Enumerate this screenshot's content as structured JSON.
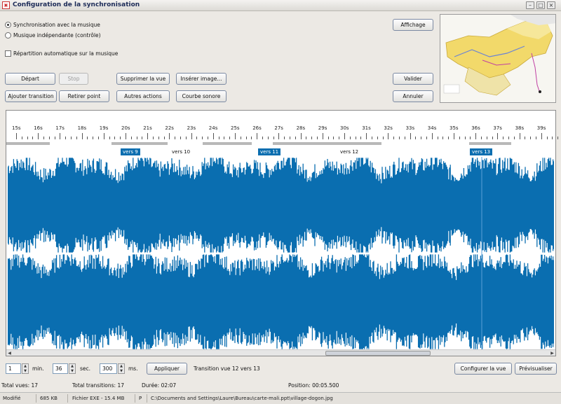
{
  "window": {
    "title": "Configuration de la synchronisation",
    "app_icon": "app-icon",
    "controls": [
      "minimize-icon",
      "maximize-icon",
      "close-icon"
    ]
  },
  "options": {
    "radio1": "Synchronisation avec la musique",
    "radio2": "Musique indépendante (contrôle)",
    "radio_selected": "radio1",
    "checkbox": "Répartition automatique sur la musique",
    "checkbox_checked": false
  },
  "buttons": {
    "affichage": "Affichage",
    "depart": "Départ",
    "stop": "Stop",
    "supprimer": "Supprimer la vue",
    "inserer": "Insérer image...",
    "valider": "Valider",
    "ajouter": "Ajouter transition",
    "retirer": "Retirer point",
    "autres": "Autres actions",
    "courbe": "Courbe sonore",
    "annuler": "Annuler",
    "appliquer": "Appliquer",
    "configurer": "Configurer la vue",
    "previsualiser": "Prévisualiser"
  },
  "timeline": {
    "ticks": [
      "15s",
      "16s",
      "17s",
      "18s",
      "19s",
      "20s",
      "21s",
      "22s",
      "23s",
      "24s",
      "25s",
      "26s",
      "27s",
      "28s",
      "29s",
      "30s",
      "31s",
      "32s",
      "33s",
      "34s",
      "35s",
      "36s",
      "37s",
      "38s",
      "39s"
    ],
    "markers": [
      {
        "label": "vers 9",
        "active": true
      },
      {
        "label": "vers 10",
        "active": false
      },
      {
        "label": "vers 11",
        "active": true
      },
      {
        "label": "vers 12",
        "active": false
      },
      {
        "label": "vers 13",
        "active": true
      }
    ],
    "waveform_color": "#0a6eb0"
  },
  "position": {
    "min_value": "1",
    "min_unit": "min.",
    "sec_value": "36",
    "sec_unit": "sec.",
    "ms_value": "300",
    "ms_unit": "ms.",
    "transition_text": "Transition vue 12 vers 13"
  },
  "stats": {
    "total_vues": "Total vues: 17",
    "total_transitions": "Total transitions: 17",
    "duree": "Durée: 02:07",
    "position": "Position: 00:05.500"
  },
  "statusbar": {
    "state": "Modifié",
    "size": "685 KB",
    "type": "Fichier EXE - 15.4 MB",
    "flag": "P",
    "path": "C:\\Documents and Settings\\Laure\\Bureau\\carte-mali.ppt\\village-dogon.jpg"
  }
}
